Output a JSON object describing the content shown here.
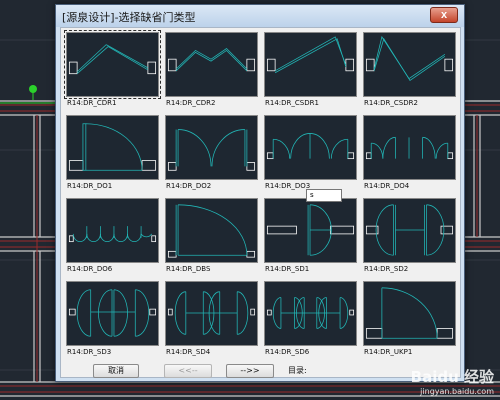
{
  "dialog": {
    "title": "[源泉设计]-选择缺省门类型",
    "close_glyph": "x"
  },
  "thumbnails": [
    {
      "label": "R14:DR_CDR1",
      "icon": "sliding-double-door-icon"
    },
    {
      "label": "R14:DR_CDR2",
      "icon": "sliding-door-variant-icon"
    },
    {
      "label": "R14:DR_CSDR1",
      "icon": "sliding-door-arc-icon"
    },
    {
      "label": "R14:DR_CSDR2",
      "icon": "sliding-door-zigzag-icon"
    },
    {
      "label": "R14:DR_DO1",
      "icon": "single-swing-door-icon"
    },
    {
      "label": "R14:DR_DO2",
      "icon": "double-swing-door-icon"
    },
    {
      "label": "R14:DR_DO3",
      "icon": "triple-swing-door-icon"
    },
    {
      "label": "R14:DR_DO4",
      "icon": "quad-swing-door-icon"
    },
    {
      "label": "R14:DR_DO6",
      "icon": "six-panel-door-icon"
    },
    {
      "label": "R14:DR_DBS",
      "icon": "large-swing-door-icon"
    },
    {
      "label": "R14:DR_SD1",
      "icon": "half-circle-door-icon"
    },
    {
      "label": "R14:DR_SD2",
      "icon": "double-half-circle-door-icon"
    },
    {
      "label": "R14:DR_SD3",
      "icon": "three-half-circle-door-icon"
    },
    {
      "label": "R14:DR_SD4",
      "icon": "four-half-circle-door-icon"
    },
    {
      "label": "R14:DR_SD6",
      "icon": "six-half-circle-door-icon"
    },
    {
      "label": "R14:DR_UKP1",
      "icon": "unknown-door-icon"
    }
  ],
  "tooltip": "s",
  "buttons": {
    "cancel": "取消",
    "prev": "<<--",
    "next": "-->>"
  },
  "page_label": "目录:",
  "watermark": {
    "brand": "Baidu 经验",
    "url": "jingyan.baidu.com"
  },
  "colors": {
    "cad_bg": "#212831",
    "door_line": "#22b5b5",
    "wall_line": "#9a2a2a",
    "selection": "#ffffff"
  }
}
